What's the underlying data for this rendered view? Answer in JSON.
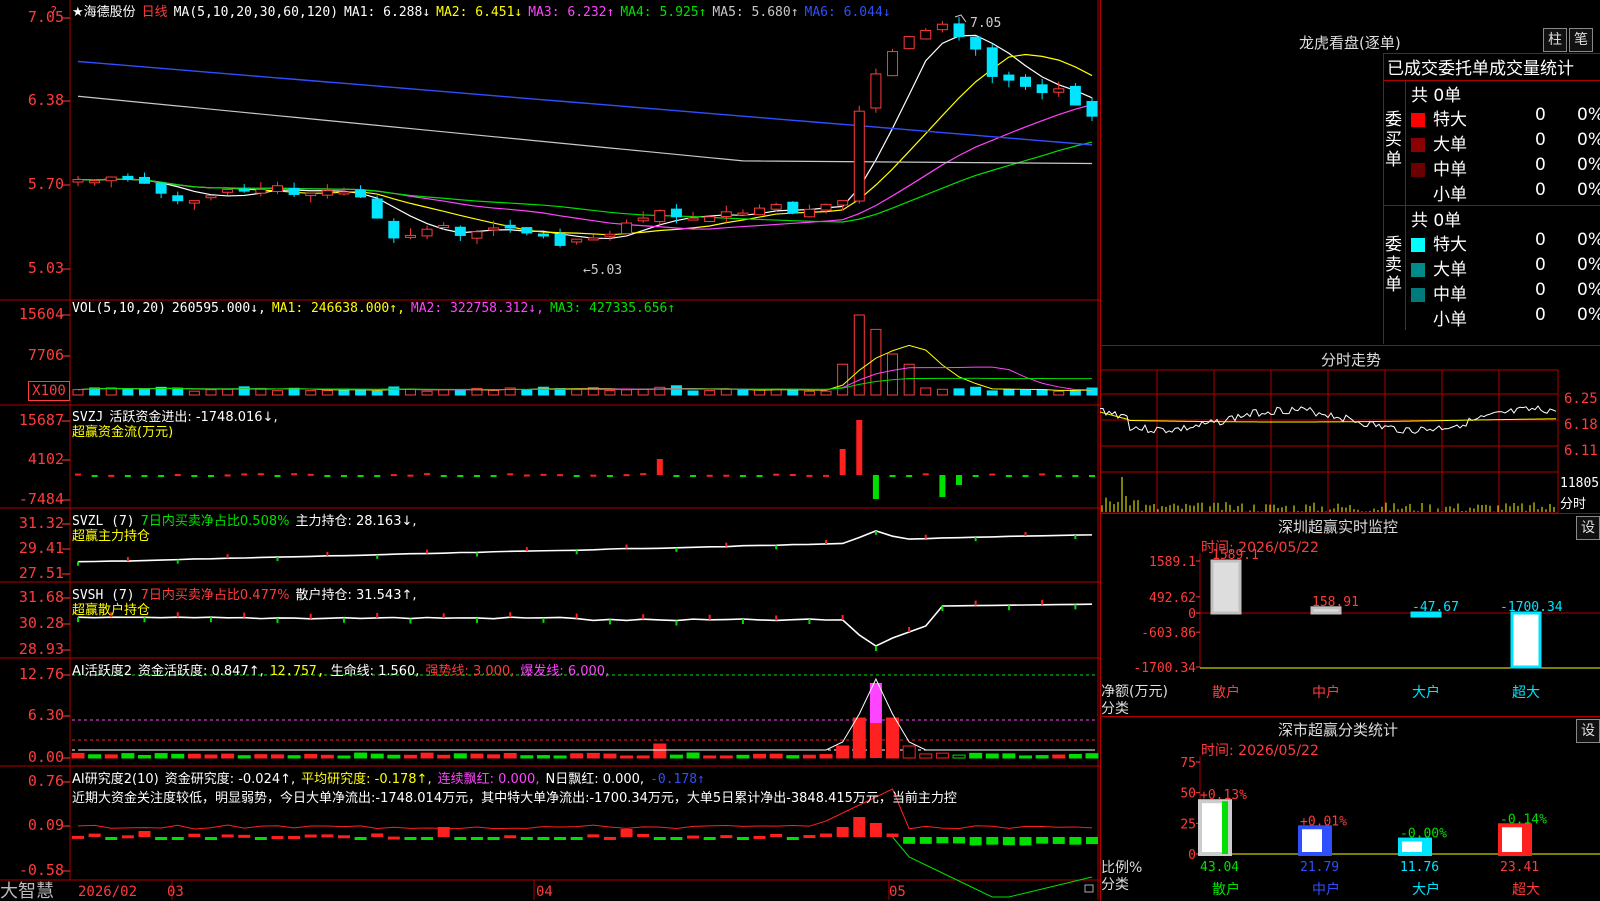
{
  "stock": {
    "title": "★海德股份",
    "period": "日线"
  },
  "main_header": {
    "ma_set": "MA(5,10,20,30,60,120)",
    "ma1": "MA1: 6.288↓",
    "ma2": "MA2: 6.451↓",
    "ma3": "MA3: 6.232↑",
    "ma4": "MA4: 5.925↑",
    "ma5": "MA5: 5.680↑",
    "ma6": "MA6: 6.044↓"
  },
  "main_axis": [
    "7.05",
    "6.38",
    "5.70",
    "5.03"
  ],
  "annotations": {
    "high": "7.05",
    "low": "←5.03"
  },
  "vol_header": {
    "name": "VOL(5,10,20)",
    "val": "260595.000↓,",
    "ma1": "MA1: 246638.000↑,",
    "ma2": "MA2: 322758.312↓,",
    "ma3": "MA3: 427335.656↑"
  },
  "vol_axis": [
    "15604",
    "7706",
    "X100"
  ],
  "svzj": {
    "name": "SVZJ",
    "line1": "活跃资金进出: -1748.016↓,",
    "line2": "超赢资金流(万元)",
    "axis": [
      "15687",
      "4102",
      "-7484"
    ]
  },
  "svzl": {
    "name": "SVZL (7)",
    "ratio": "7日内买卖净占比0.508%",
    "hold": "主力持仓: 28.163↓,",
    "line2": "超赢主力持仓",
    "axis": [
      "31.32",
      "29.41",
      "27.51"
    ]
  },
  "svsh": {
    "name": "SVSH (7)",
    "ratio": "7日内买卖净占比0.477%",
    "hold": "散户持仓: 31.543↑,",
    "line2": "超赢散户持仓",
    "axis": [
      "31.68",
      "30.28",
      "28.93"
    ]
  },
  "ai_active": {
    "name": "AI活跃度2",
    "a": "资金活跃度: 0.847↑,",
    "b": "12.757,",
    "c": "生命线: 1.560,",
    "d": "强势线: 3.000,",
    "e": "爆发线: 6.000,",
    "axis": [
      "12.76",
      "6.30",
      "0.00"
    ]
  },
  "ai_research": {
    "name": "AI研究度2(10)",
    "a": "资金研究度: -0.024↑,",
    "b": "平均研究度: -0.178↑,",
    "c": "连续飘红: 0.000,",
    "d": "N日飘红: 0.000,",
    "e": "-0.178↑",
    "commentary": "近期大资金关注度较低，明显弱势，今日大单净流出:-1748.014万元，其中特大单净流出:-1700.34万元，大单5日累计净出-3848.415万元，当前主力控",
    "axis": [
      "0.76",
      "0.09",
      "-0.58"
    ]
  },
  "date_axis": {
    "brand": "大智慧",
    "labels": [
      "2026/02",
      "03",
      "04",
      "05"
    ]
  },
  "dragon": {
    "title": "龙虎看盘(逐单)",
    "btn_col": "柱",
    "btn_pen": "笔",
    "tabs": "已成交委托单成交量统计",
    "buy_label": "委买单",
    "sell_label": "委卖单",
    "buy_total": "共 0单",
    "sell_total": "共 0单",
    "buy_rows": [
      {
        "label": "特大",
        "count": "0",
        "pct": "0%",
        "color": "#ff0000"
      },
      {
        "label": "大单",
        "count": "0",
        "pct": "0%",
        "color": "#8b0000"
      },
      {
        "label": "中单",
        "count": "0",
        "pct": "0%",
        "color": "#6b0000"
      },
      {
        "label": "小单",
        "count": "0",
        "pct": "0%",
        "color": ""
      }
    ],
    "sell_rows": [
      {
        "label": "特大",
        "count": "0",
        "pct": "0%",
        "color": "#00ffff"
      },
      {
        "label": "大单",
        "count": "0",
        "pct": "0%",
        "color": "#008b8b"
      },
      {
        "label": "中单",
        "count": "0",
        "pct": "0%",
        "color": "#007a7a"
      },
      {
        "label": "小单",
        "count": "0",
        "pct": "0%",
        "color": ""
      }
    ]
  },
  "intraday": {
    "title": "分时走势",
    "axis": [
      "6.25",
      "6.18",
      "6.11"
    ],
    "vol_label": "11805",
    "vol_unit": "分时"
  },
  "monitor": {
    "title": "深圳超赢实时监控",
    "btn": "设",
    "time": "时间: 2026/05/22",
    "axis": [
      "1589.1",
      "492.62",
      "0",
      "-603.86",
      "-1700.34"
    ],
    "unit": "净额(万元)",
    "unit2": "分类",
    "categories": [
      "散户",
      "中户",
      "大户",
      "超大"
    ],
    "values": [
      1589.1,
      158.91,
      -47.67,
      -1700.34
    ],
    "value_labels": [
      "1589.1",
      "158.91",
      "-47.67",
      "-1700.34"
    ]
  },
  "classify": {
    "title": "深市超赢分类统计",
    "btn": "设",
    "time": "时间: 2026/05/22",
    "axis": [
      "75",
      "50",
      "25",
      "0"
    ],
    "unit": "比例%",
    "unit2": "分类",
    "categories": [
      "散户",
      "中户",
      "大户",
      "超大"
    ],
    "values": [
      43.04,
      21.79,
      11.76,
      23.41
    ],
    "value_labels": [
      "43.04",
      "21.79",
      "11.76",
      "23.41"
    ],
    "change_labels": [
      "+0.13%",
      "+0.01%",
      "-0.00%",
      "-0.14%"
    ]
  },
  "colors": {
    "up": "#ff3b3b",
    "down": "#00e5ff",
    "grid": "#b00000",
    "ma1": "#ffffff",
    "ma2": "#ffff00",
    "ma3": "#ff44ff",
    "ma4": "#00e000",
    "ma5": "#c8c8c8",
    "ma6": "#2f4fff"
  }
}
